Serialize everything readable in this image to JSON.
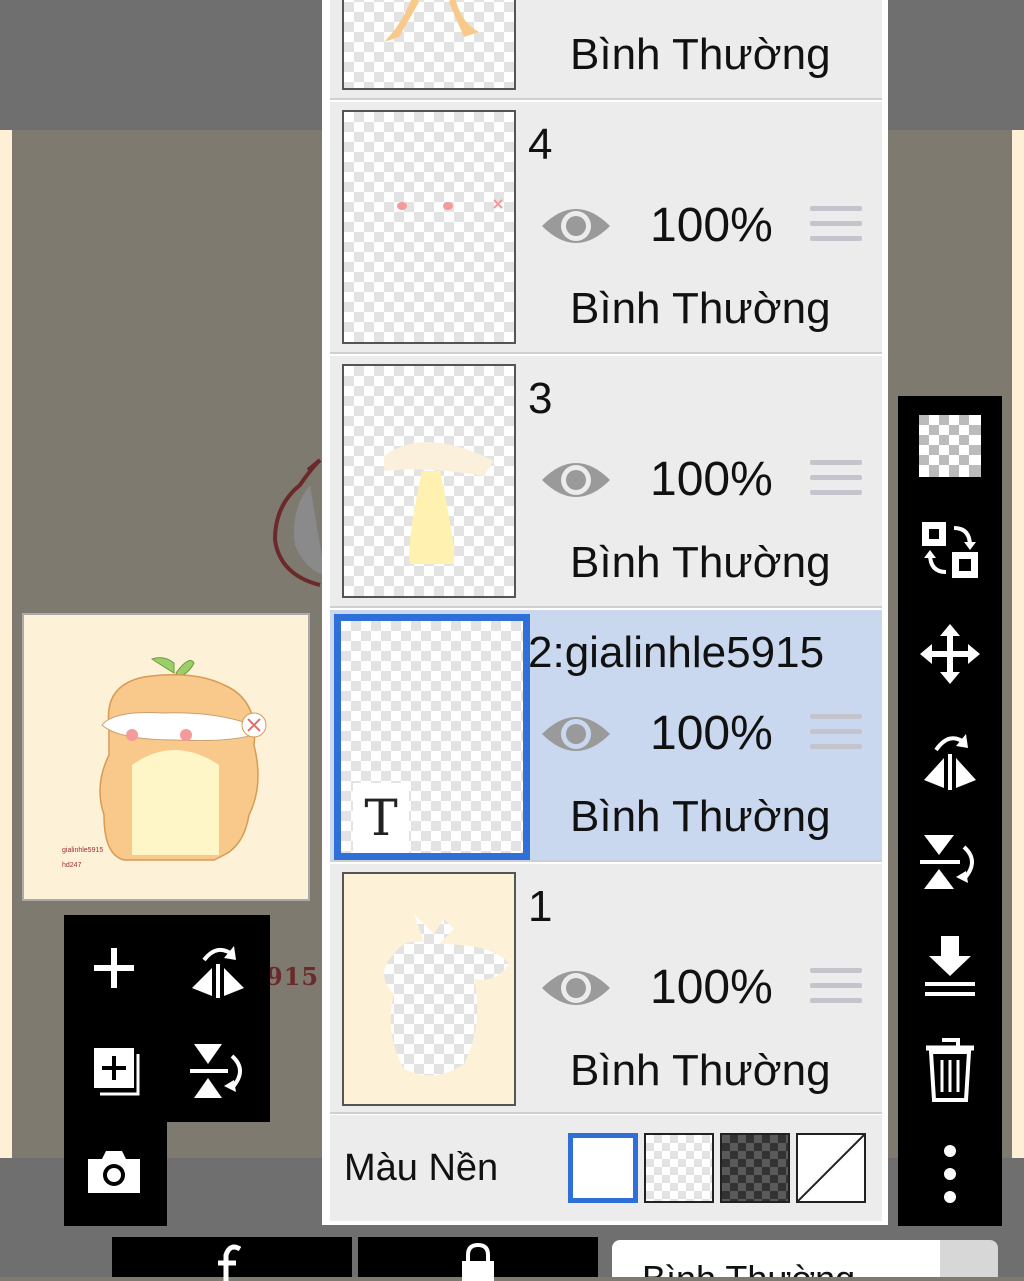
{
  "layers": [
    {
      "name": "",
      "opacity": "",
      "blend": "Bình Thường"
    },
    {
      "name": "4",
      "opacity": "100%",
      "blend": "Bình Thường"
    },
    {
      "name": "3",
      "opacity": "100%",
      "blend": "Bình Thường"
    },
    {
      "name": "2:gialinhle5915",
      "opacity": "100%",
      "blend": "Bình Thường",
      "selected": true,
      "type_marker": "T"
    },
    {
      "name": "1",
      "opacity": "100%",
      "blend": "Bình Thường"
    }
  ],
  "background": {
    "label": "Màu Nền",
    "options": [
      "white",
      "transparent-light",
      "transparent-dark",
      "none"
    ],
    "selected": "white"
  },
  "preview": {
    "signature_line1": "gialinhle5915",
    "signature_line2": "hd247"
  },
  "canvas_partial_text": "915",
  "left_tools": [
    "add-layer-icon",
    "flip-horizontal-icon",
    "add-layer-copy-icon",
    "flip-vertical-icon",
    "camera-icon"
  ],
  "right_tools": [
    "transparency-icon",
    "swap-icon",
    "move-icon",
    "flip-horizontal-icon",
    "flip-vertical-icon",
    "merge-down-icon",
    "trash-icon",
    "more-icon"
  ],
  "bottom": {
    "blend_mode": "Bình Thường"
  },
  "colors": {
    "selected_layer": "#cad8ef",
    "selection_border": "#2f6fd8",
    "panel": "#ececec",
    "canvas_bg": "#fdf1d8"
  }
}
